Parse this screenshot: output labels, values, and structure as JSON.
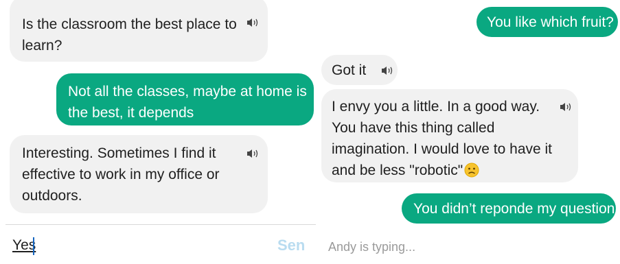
{
  "left_chat": {
    "messages": [
      {
        "sender": "bot",
        "text_lines": [
          "Is the classroom the best place to",
          "learn?"
        ]
      },
      {
        "sender": "user",
        "text_lines": [
          "Not all the classes, maybe at home is",
          "the best, it depends"
        ]
      },
      {
        "sender": "bot",
        "text_lines": [
          "Interesting. Sometimes I find it",
          "effective to work in my office or",
          "outdoors."
        ]
      }
    ],
    "input_value": "Yes",
    "send_label": "Sen"
  },
  "right_chat": {
    "messages": [
      {
        "sender": "user",
        "text_lines": [
          "You like which fruit?"
        ]
      },
      {
        "sender": "bot",
        "text_lines": [
          "Got it"
        ]
      },
      {
        "sender": "bot",
        "text_lines": [
          "I envy you a little. In a good way.",
          "You have this thing called",
          "imagination. I would love to have it",
          "and be less \"robotic\""
        ],
        "emoji": "slightly-frowning-face"
      },
      {
        "sender": "user",
        "text_lines": [
          "You didn’t reponde my question"
        ]
      }
    ],
    "typing_status": "Andy is typing..."
  },
  "colors": {
    "user_bubble": "#0aa881",
    "bot_bubble": "#f1f1f1",
    "send_button": "#b9dcf0",
    "typing_text": "#9a9a9a"
  }
}
